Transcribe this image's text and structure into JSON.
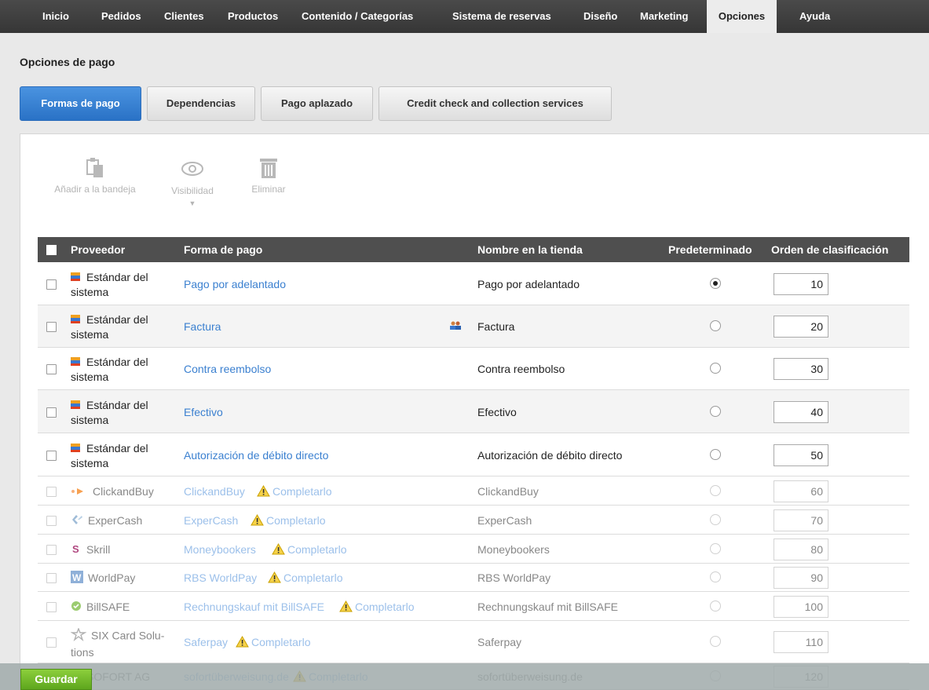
{
  "nav": {
    "items": [
      "Inicio",
      "Pedidos",
      "Clientes",
      "Productos",
      "Contenido / Categorías",
      "Sistema de reservas",
      "Diseño",
      "Marketing",
      "Opciones",
      "Ayuda"
    ],
    "active": "Opciones"
  },
  "page": {
    "title": "Opciones de pago"
  },
  "tabs": [
    "Formas de pago",
    "Dependencias",
    "Pago aplazado",
    "Credit check and collection services"
  ],
  "toolbar": {
    "add_to_tray": "Añadir a la bandeja",
    "visibility": "Visibilidad",
    "visibility_arrow": "▼",
    "delete": "Eliminar"
  },
  "table": {
    "headers": {
      "provider": "Proveedor",
      "method": "Forma de pago",
      "shop_name": "Nombre en la tienda",
      "default": "Predeterminado",
      "sort_order": "Orden de clasificación"
    },
    "complete_label": "Completarlo",
    "rows": [
      {
        "provider_line1": "Estándar del",
        "provider_line2": "sistema",
        "provider_icon": "system-standard-icon",
        "method": "Pago por adelantado",
        "shop_name": "Pago por adelantado",
        "default": true,
        "sort": "10",
        "disabled": false,
        "needs_completion": false
      },
      {
        "provider_line1": "Estándar del",
        "provider_line2": "sistema",
        "provider_icon": "system-standard-icon",
        "method": "Factura",
        "shop_name": "Factura",
        "default": false,
        "sort": "20",
        "disabled": false,
        "needs_completion": false,
        "customer_group_icon": true
      },
      {
        "provider_line1": "Estándar del",
        "provider_line2": "sistema",
        "provider_icon": "system-standard-icon",
        "method": "Contra reembolso",
        "shop_name": "Contra reembolso",
        "default": false,
        "sort": "30",
        "disabled": false,
        "needs_completion": false
      },
      {
        "provider_line1": "Estándar del",
        "provider_line2": "sistema",
        "provider_icon": "system-standard-icon",
        "method": "Efectivo",
        "shop_name": "Efectivo",
        "default": false,
        "sort": "40",
        "disabled": false,
        "needs_completion": false
      },
      {
        "provider_line1": "Estándar del",
        "provider_line2": "sistema",
        "provider_icon": "system-standard-icon",
        "method": "Autorización de débito directo",
        "shop_name": "Autorización de débito directo",
        "default": false,
        "sort": "50",
        "disabled": false,
        "needs_completion": false
      },
      {
        "provider_line1": "ClickandBuy",
        "provider_line2": "",
        "provider_icon": "clickandbuy-icon",
        "method": "ClickandBuy",
        "shop_name": "ClickandBuy",
        "default": false,
        "sort": "60",
        "disabled": true,
        "needs_completion": true
      },
      {
        "provider_line1": "ExperCash",
        "provider_line2": "",
        "provider_icon": "expercash-icon",
        "method": "ExperCash",
        "shop_name": "ExperCash",
        "default": false,
        "sort": "70",
        "disabled": true,
        "needs_completion": true
      },
      {
        "provider_line1": "Skrill",
        "provider_line2": "",
        "provider_icon": "skrill-icon",
        "method": "Moneybookers",
        "shop_name": "Moneybookers",
        "default": false,
        "sort": "80",
        "disabled": true,
        "needs_completion": true
      },
      {
        "provider_line1": "WorldPay",
        "provider_line2": "",
        "provider_icon": "worldpay-icon",
        "method": "RBS WorldPay",
        "shop_name": "RBS WorldPay",
        "default": false,
        "sort": "90",
        "disabled": true,
        "needs_completion": true
      },
      {
        "provider_line1": "BillSAFE",
        "provider_line2": "",
        "provider_icon": "billsafe-icon",
        "method": "Rechnungskauf mit BillSAFE",
        "shop_name": "Rechnungskauf mit BillSAFE",
        "default": false,
        "sort": "100",
        "disabled": true,
        "needs_completion": true
      },
      {
        "provider_line1": "SIX Card Solu-",
        "provider_line2": "tions",
        "provider_icon": "six-card-icon",
        "method": "Saferpay",
        "shop_name": "Saferpay",
        "default": false,
        "sort": "110",
        "disabled": true,
        "needs_completion": true
      },
      {
        "provider_line1": "SOFORT AG",
        "provider_line2": "",
        "provider_icon": "sofort-icon",
        "method": "sofortüberweisung.de",
        "shop_name": "sofortüberweisung.de",
        "default": false,
        "sort": "120",
        "disabled": true,
        "needs_completion": true
      }
    ]
  },
  "footer": {
    "save_label": "Guardar"
  },
  "colors": {
    "accent": "#2a72c6",
    "link": "#3b80d0",
    "save": "#5ea61d",
    "header": "#4f4f4f"
  }
}
